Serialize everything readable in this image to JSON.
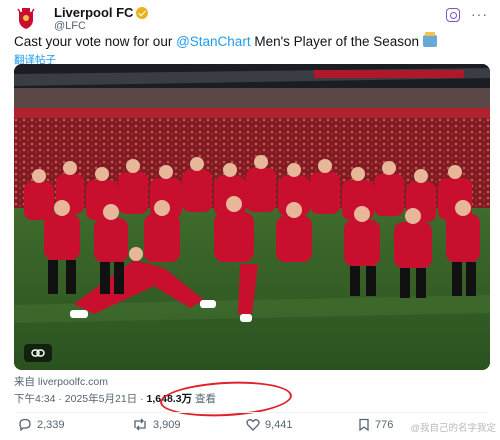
{
  "account": {
    "display_name": "Liverpool FC",
    "handle": "@LFC",
    "avatar_icon": "lfc-crest-icon",
    "verified_icon": "gold-verified-badge-icon",
    "affiliate_icon": "instagram-icon",
    "more_icon": "more-options-icon"
  },
  "tweet": {
    "text_before": "Cast your vote now for our ",
    "mention": "@StanChart",
    "text_after": " Men's Player of the Season",
    "emoji_icon": "ballot-box-icon",
    "translate_label": "翻译帖子"
  },
  "media": {
    "link_icon": "link-icon"
  },
  "card": {
    "source": "来自 liverpoolfc.com"
  },
  "meta": {
    "time": "下午4:34",
    "separator": " · ",
    "date": "2025年5月21日",
    "views_count": "1,648.3万",
    "views_label": "查看"
  },
  "actions": {
    "replies": "2,339",
    "retweets": "3,909",
    "likes": "9,441",
    "bookmarks": "776"
  },
  "watermark": "@我自己的名字我定",
  "colors": {
    "accent": "#1d9bf0",
    "annotation": "#e0202a",
    "verified": "#e8b21a",
    "lfc_red": "#c8102e"
  }
}
